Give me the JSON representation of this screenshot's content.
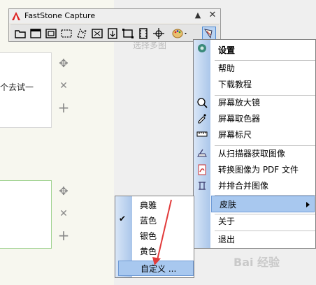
{
  "app": {
    "title": "FastStone Capture",
    "minimize": "▲",
    "close": "✕"
  },
  "background": {
    "card1_text": "个去试一",
    "ghost_lines": [
      "选择多图"
    ],
    "controls": {
      "move": "✥",
      "delete": "✕",
      "add": "+"
    }
  },
  "toolbar": {
    "icons": [
      "open-icon",
      "capture-window-icon",
      "capture-object-icon",
      "capture-rectangle-icon",
      "capture-freehand-icon",
      "capture-fullscreen-icon",
      "capture-scrolling-icon",
      "capture-fixed-region-icon",
      "capture-video-icon",
      "crosshair-icon",
      "palette-icon",
      "settings-icon"
    ]
  },
  "menu": {
    "items": [
      {
        "label": "设置",
        "icon": "gear-icon",
        "bold": true
      },
      {
        "label": "帮助",
        "icon": ""
      },
      {
        "label": "下载教程",
        "icon": ""
      },
      {
        "label": "屏幕放大镜",
        "icon": "magnifier-icon"
      },
      {
        "label": "屏幕取色器",
        "icon": "eyedropper-icon"
      },
      {
        "label": "屏幕标尺",
        "icon": "ruler-icon"
      },
      {
        "label": "从扫描器获取图像",
        "icon": "scanner-icon"
      },
      {
        "label": "转换图像为 PDF 文件",
        "icon": "pdf-icon"
      },
      {
        "label": "并排合并图像",
        "icon": "merge-icon"
      },
      {
        "label": "皮肤",
        "icon": "",
        "submenu": true
      },
      {
        "label": "关于",
        "icon": ""
      },
      {
        "label": "退出",
        "icon": ""
      }
    ]
  },
  "submenu": {
    "items": [
      "典雅",
      "蓝色",
      "银色",
      "黄色",
      "自定义 ..."
    ],
    "checked": "✔"
  },
  "watermark": "Bai 经验"
}
